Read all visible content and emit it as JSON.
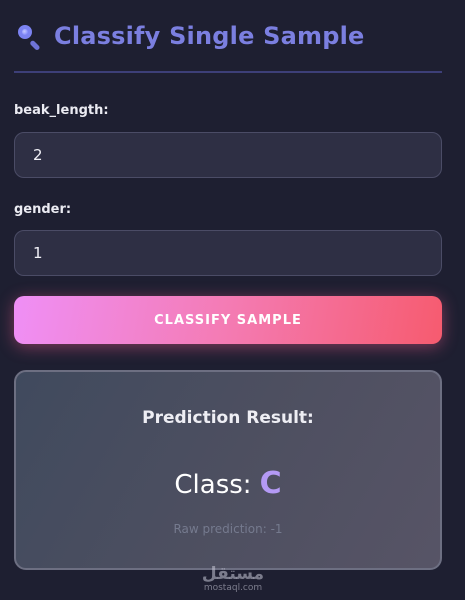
{
  "header": {
    "icon": "magnifier-icon",
    "title": "Classify Single Sample"
  },
  "form": {
    "fields": [
      {
        "label": "beak_length:",
        "value": "2"
      },
      {
        "label": "gender:",
        "value": "1"
      }
    ],
    "submit_label": "CLASSIFY SAMPLE"
  },
  "result": {
    "title": "Prediction Result:",
    "class_label": "Class:",
    "class_value": "C",
    "raw_prediction": "Raw prediction: -1"
  },
  "watermark": {
    "mark": "مستقل",
    "text": "mostaql.com"
  },
  "colors": {
    "background": "#1e1f31",
    "title": "#7b7fe0",
    "button_gradient_start": "#ef8ff6",
    "button_gradient_end": "#f65b6f",
    "class_value": "#b49af5"
  }
}
